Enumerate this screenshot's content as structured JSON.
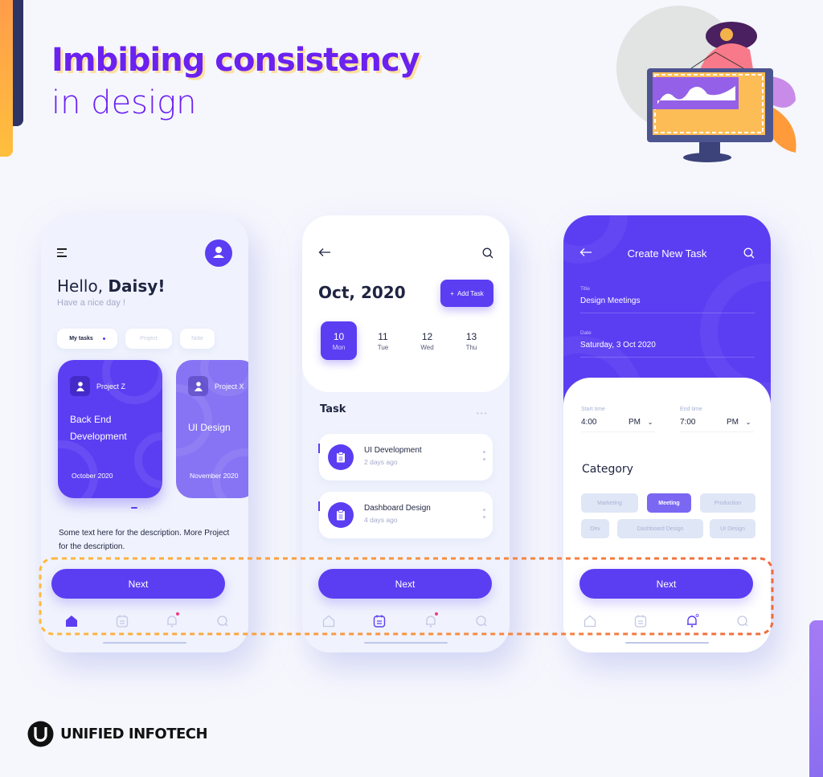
{
  "headline": {
    "line1": "Imbibing consistency",
    "line2": "in design"
  },
  "colors": {
    "primary": "#5b3ef2",
    "headline": "#6b21f0",
    "headline_shadow": "#fde0a0",
    "highlight_dash_start": "#ffb93d",
    "highlight_dash_end": "#f06a3f",
    "text_dark": "#1f2440",
    "muted": "#a3a9c8"
  },
  "screen_home": {
    "greeting_prefix": "Hello, ",
    "greeting_name": "Daisy!",
    "subtitle": "Have a nice day !",
    "chips": [
      {
        "label": "My tasks",
        "active": true
      },
      {
        "label": "Project",
        "active": false
      },
      {
        "label": "Note",
        "active": false
      }
    ],
    "project_cards": [
      {
        "project": "Project Z",
        "title": "Back End Development",
        "date": "October 2020"
      },
      {
        "project": "Project X",
        "title": "UI Design",
        "date": "November 2020"
      }
    ],
    "pager": {
      "current": 1,
      "total": 4
    },
    "description": "Some text here for the description. More Project for the description.",
    "next_label": "Next",
    "active_tab": "home"
  },
  "screen_calendar": {
    "month": "Oct, 2020",
    "add_task_label": "Add Task",
    "days": [
      {
        "num": "10",
        "weekday": "Mon",
        "active": true
      },
      {
        "num": "11",
        "weekday": "Tue",
        "active": false
      },
      {
        "num": "12",
        "weekday": "Wed",
        "active": false
      },
      {
        "num": "13",
        "weekday": "Thu",
        "active": false
      }
    ],
    "task_heading": "Task",
    "tasks": [
      {
        "title": "UI Development",
        "time": "2 days ago"
      },
      {
        "title": "Dashboard Design",
        "time": "4 days ago"
      }
    ],
    "next_label": "Next",
    "active_tab": "calendar"
  },
  "screen_create": {
    "title": "Create New Task",
    "fields": {
      "title_label": "Title",
      "title_value": "Design Meetings",
      "date_label": "Date",
      "date_value": "Saturday, 3 Oct 2020"
    },
    "start_time": {
      "label": "Start time",
      "value": "4:00",
      "period": "PM"
    },
    "end_time": {
      "label": "End time",
      "value": "7:00",
      "period": "PM"
    },
    "category_heading": "Category",
    "categories": [
      {
        "label": "Marketing",
        "active": false
      },
      {
        "label": "Meeting",
        "active": true
      },
      {
        "label": "Production",
        "active": false
      },
      {
        "label": "Dev",
        "active": false
      },
      {
        "label": "Dashboard Design",
        "active": false
      },
      {
        "label": "UI Design",
        "active": false
      }
    ],
    "next_label": "Next",
    "active_tab": "notifications"
  },
  "tabbar_icons": [
    "home-icon",
    "calendar-icon",
    "bell-icon",
    "search-icon"
  ],
  "brand": {
    "name": "UNIFIED INFOTECH"
  }
}
